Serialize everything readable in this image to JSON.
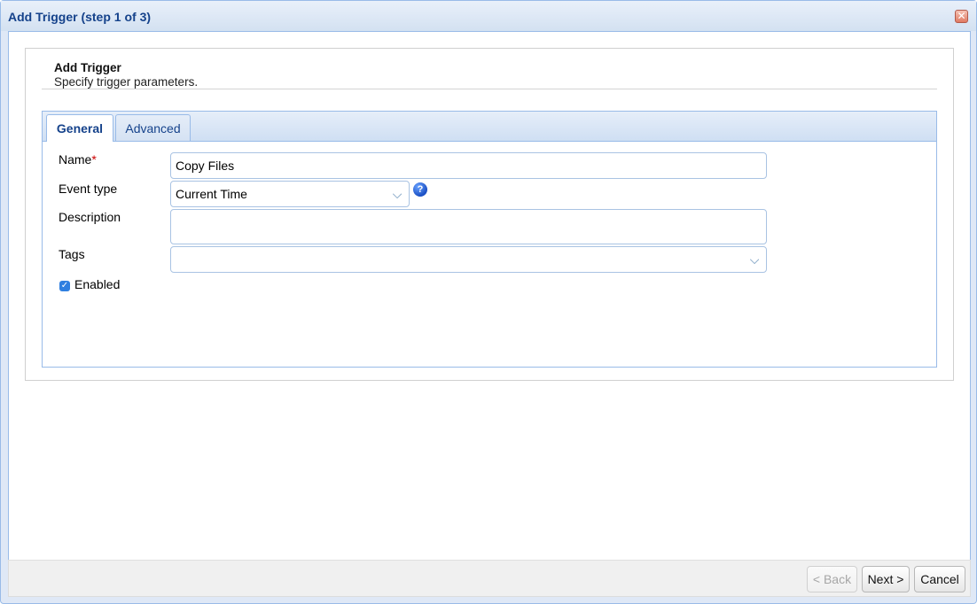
{
  "window": {
    "title": "Add Trigger (step 1 of 3)",
    "close_glyph": "✕"
  },
  "header": {
    "title": "Add Trigger",
    "subtitle": "Specify trigger parameters."
  },
  "tabs": [
    {
      "label": "General",
      "active": true
    },
    {
      "label": "Advanced",
      "active": false
    }
  ],
  "form": {
    "name_label": "Name",
    "required_mark": "*",
    "name_value": "Copy Files",
    "event_type_label": "Event type",
    "event_type_value": "Current Time",
    "description_label": "Description",
    "description_value": "",
    "tags_label": "Tags",
    "tags_value": "",
    "enabled_label": "Enabled",
    "enabled_checked": true,
    "help_glyph": "?",
    "dropdown_glyph": "⌵",
    "check_glyph": "✓"
  },
  "buttons": {
    "back": "< Back",
    "next": "Next >",
    "cancel": "Cancel"
  },
  "colors": {
    "title_text": "#15428b",
    "accent_border": "#99bbe8",
    "required": "#cc0000",
    "checkbox": "#2f7fe0"
  }
}
